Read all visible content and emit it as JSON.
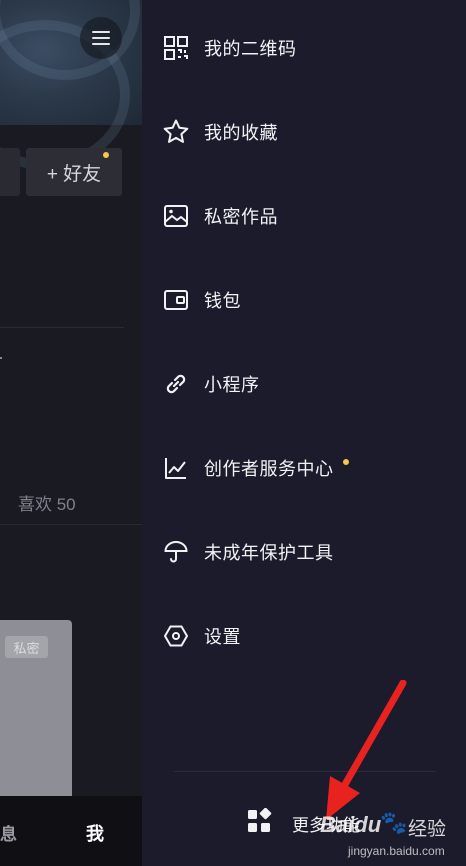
{
  "left_page": {
    "add_friend_label": "+ 好友",
    "likes_text": "喜欢 50",
    "private_badge": "私密",
    "tab_message_partial": "息",
    "tab_me": "我"
  },
  "drawer": {
    "items": [
      {
        "label": "我的二维码",
        "icon": "qr-code-icon"
      },
      {
        "label": "我的收藏",
        "icon": "star-icon"
      },
      {
        "label": "私密作品",
        "icon": "private-works-icon"
      },
      {
        "label": "钱包",
        "icon": "wallet-icon"
      },
      {
        "label": "小程序",
        "icon": "link-icon"
      },
      {
        "label": "创作者服务中心",
        "icon": "chart-icon",
        "has_dot": true
      },
      {
        "label": "未成年保护工具",
        "icon": "umbrella-icon"
      },
      {
        "label": "设置",
        "icon": "hexagon-settings-icon"
      }
    ],
    "more_label": "更多功能",
    "more_icon": "grid-apps-icon"
  },
  "watermark": {
    "logo_text": "Bai",
    "logo_du": "du",
    "logo_suffix": "经验",
    "url": "jingyan.baidu.com"
  },
  "colors": {
    "drawer_bg": "#1c1b2b",
    "notification_dot": "#f3c84b",
    "arrow_red": "#e8231f"
  }
}
